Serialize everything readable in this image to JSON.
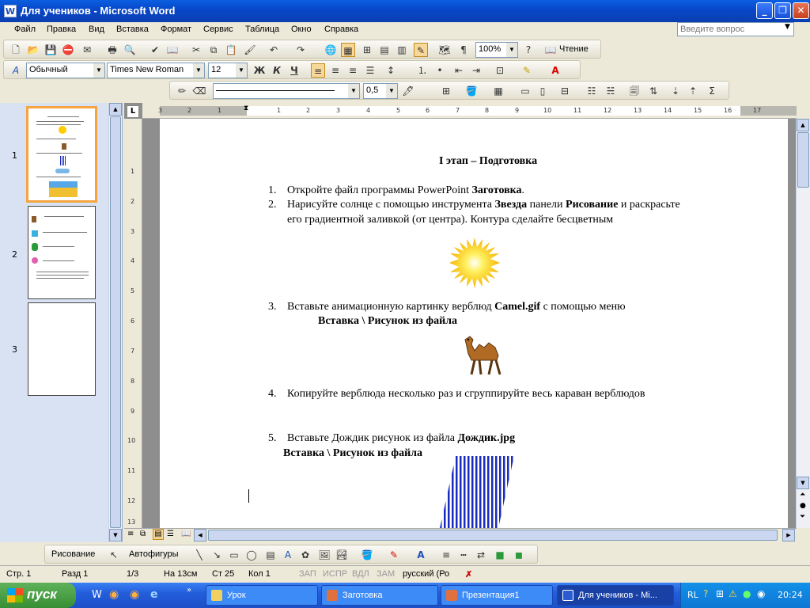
{
  "window": {
    "app_icon": "W",
    "title": "Для учеников - Microsoft Word",
    "btn_minimize": "_",
    "btn_maximize": "❐",
    "btn_close": "✕"
  },
  "menu": {
    "items": [
      "Файл",
      "Правка",
      "Вид",
      "Вставка",
      "Формат",
      "Сервис",
      "Таблица",
      "Окно",
      "Справка"
    ],
    "ask_placeholder": "Введите вопрос"
  },
  "toolbar_standard": {
    "zoom": "100%",
    "reading_label": "Чтение"
  },
  "toolbar_format": {
    "style": "Обычный",
    "font": "Times New Roman",
    "size": "12",
    "bold": "Ж",
    "italic": "К",
    "underline": "Ч"
  },
  "toolbar_tables": {
    "line_weight": "0,5"
  },
  "slides_panel": {
    "numbers": [
      "1",
      "2",
      "3"
    ]
  },
  "ruler": {
    "ticks": [
      "3",
      "2",
      "1",
      "1",
      "2",
      "3",
      "4",
      "5",
      "6",
      "7",
      "8",
      "9",
      "10",
      "11",
      "12",
      "13",
      "14",
      "15",
      "16",
      "17"
    ],
    "vticks": [
      "1",
      "2",
      "3",
      "4",
      "5",
      "6",
      "7",
      "8",
      "9",
      "10",
      "11",
      "12",
      "13"
    ]
  },
  "document": {
    "heading": "I этап – Подготовка",
    "item1_num": "1.",
    "item1_text": "Откройте файл  программы PowerPoint ",
    "item1_bold": "Заготовка",
    "item1_end": ".",
    "item2_num": "2.",
    "item2_a": "Нарисуйте солнце с помощью инструмента ",
    "item2_b": "Звезда",
    "item2_c": " панели ",
    "item2_d": "Рисование",
    "item2_e": " и раскрасьте",
    "item2_line2": "его градиентной заливкой (от центра).  Контура сделайте бесцветным",
    "item3_num": "3.",
    "item3_a": "Вставьте анимационную картинку верблюд  ",
    "item3_b": "Camel.gif",
    "item3_c": " с помощью меню",
    "item3_menu": "Вставка \\  Рисунок из файла",
    "item4_num": "4.",
    "item4_text": "Копируйте верблюда несколько раз и сгруппируйте весь караван верблюдов",
    "item5_num": "5.",
    "item5_a": "Вставьте Дождик рисунок из файла ",
    "item5_b": "Дождик.jpg",
    "item5_menu": "Вставка \\  Рисунок из файла"
  },
  "drawing_toolbar": {
    "draw_label": "Рисование",
    "autoshapes_label": "Автофигуры"
  },
  "status": {
    "page": "Стр.  1",
    "section": "Разд  1",
    "pages": "1/3",
    "at": "На  13см",
    "line": "Ст  25",
    "col": "Кол  1",
    "rec": "ЗАП",
    "trk": "ИСПР",
    "ext": "ВДЛ",
    "ovr": "ЗАМ",
    "lang": "русский (Ро"
  },
  "taskbar": {
    "start": "пуск",
    "tasks": [
      "Урок",
      "Заготовка",
      "Презентация1",
      "Для учеников - Mi..."
    ],
    "lang": "RL",
    "time": "20:24"
  },
  "colors": {
    "title_blue": "#0a4fd0",
    "selection_orange": "#f4a440",
    "sun_yellow": "#ffd200",
    "rain_blue": "#1a2bc0"
  }
}
